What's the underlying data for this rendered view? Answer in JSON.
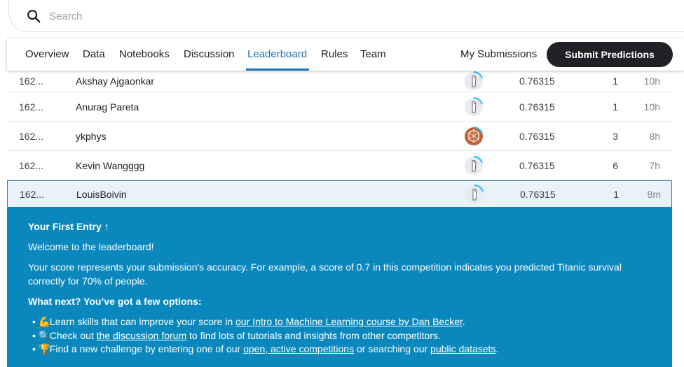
{
  "search": {
    "placeholder": "Search"
  },
  "tabs": [
    "Overview",
    "Data",
    "Notebooks",
    "Discussion",
    "Leaderboard",
    "Rules",
    "Team"
  ],
  "active_tab": "Leaderboard",
  "my_submissions": "My Submissions",
  "submit_label": "Submit Predictions",
  "rows": [
    {
      "rank": "162...",
      "name": "Akshay Ajgaonkar",
      "score": "0.76315",
      "entries": "1",
      "last": "10h",
      "avatar": "default-avatar-icon"
    },
    {
      "rank": "162...",
      "name": "Anurag Pareta",
      "score": "0.76315",
      "entries": "1",
      "last": "10h",
      "avatar": "default-avatar-icon"
    },
    {
      "rank": "162...",
      "name": "ykphys",
      "score": "0.76315",
      "entries": "3",
      "last": "8h",
      "avatar": "pattern-avatar-icon"
    },
    {
      "rank": "162...",
      "name": "Kevin Wangggg",
      "score": "0.76315",
      "entries": "6",
      "last": "7h",
      "avatar": "default-avatar-icon"
    },
    {
      "rank": "162...",
      "name": "LouisBoivin",
      "score": "0.76315",
      "entries": "1",
      "last": "8m",
      "avatar": "default-avatar-icon"
    }
  ],
  "panel": {
    "title": "Your First Entry ↑",
    "welcome": "Welcome to the leaderboard!",
    "score_text": "Your score represents your submission's accuracy. For example, a score of 0.7 in this competition indicates you predicted Titanic survival correctly for 70% of people.",
    "next": "What next? You’ve got a few options:",
    "bullets": [
      {
        "emoji": "💪",
        "pre": "Learn skills that can improve your score in ",
        "link": "our Intro to Machine Learning course by Dan Becker",
        "post": "."
      },
      {
        "emoji": "🔍",
        "pre": "Check out ",
        "link": "the discussion forum",
        "post": " to find lots of tutorials and insights from other competitors."
      },
      {
        "emoji": "🏆",
        "pre": "Find a new challenge by entering one of our ",
        "link": "open, active competitions",
        "mid": " or searching our ",
        "link2": "public datasets",
        "post": "."
      }
    ]
  },
  "colors": {
    "accent": "#1a73b5",
    "panel_bg": "#0a88bd",
    "button_bg": "#202124"
  }
}
